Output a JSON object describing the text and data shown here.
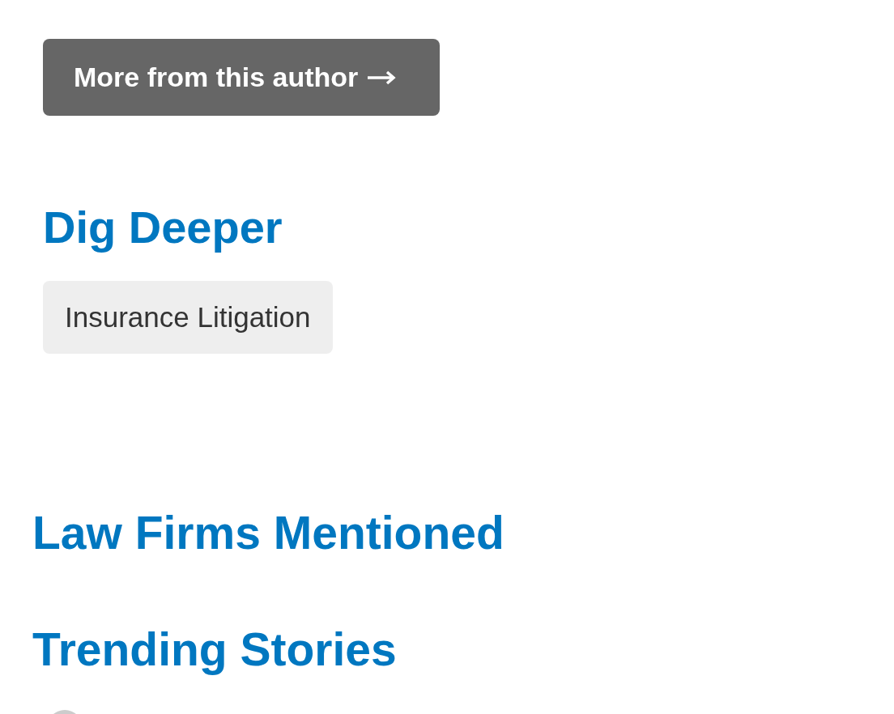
{
  "author_button": {
    "label": "More from this author"
  },
  "dig_deeper": {
    "title": "Dig Deeper",
    "tags": [
      "Insurance Litigation"
    ]
  },
  "law_firms": {
    "title": "Law Firms Mentioned"
  },
  "trending": {
    "title": "Trending Stories"
  }
}
